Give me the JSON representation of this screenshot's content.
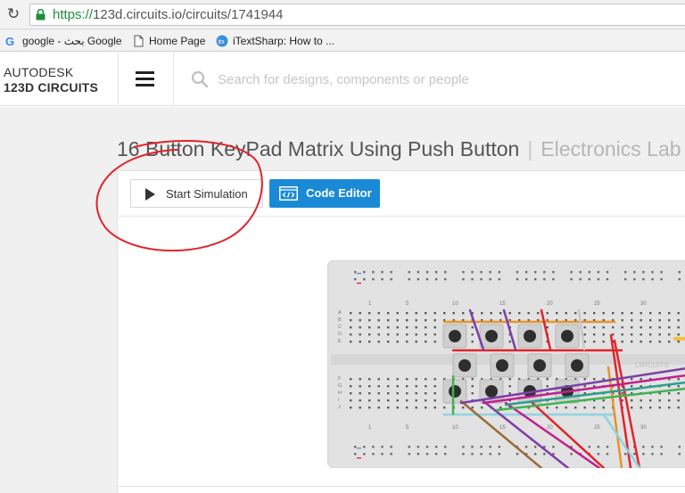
{
  "browser": {
    "url_scheme": "https://",
    "url_rest": "123d.circuits.io/circuits/1741944",
    "bookmarks": [
      {
        "label": "google - بحث Google",
        "icon": "google-icon"
      },
      {
        "label": "Home Page",
        "icon": "page-icon"
      },
      {
        "label": "iTextSharp: How to ...",
        "icon": "itextsharp-icon"
      }
    ]
  },
  "app": {
    "brand_line1": "AUTODESK",
    "brand_line2": "123D CIRCUITS",
    "search_placeholder": "Search for designs, components or people"
  },
  "circuit": {
    "title": "16 Button KeyPad Matrix Using Push Button",
    "separator": "|",
    "owner": "Electronics Lab"
  },
  "toolbar": {
    "start_simulation_label": "Start Simulation",
    "code_editor_label": "Code Editor"
  },
  "breadboard": {
    "column_numbers": [
      "1",
      "5",
      "10",
      "15",
      "20",
      "25",
      "30"
    ],
    "row_letters_top": [
      "A",
      "B",
      "C",
      "D",
      "E"
    ],
    "row_letters_bottom": [
      "F",
      "G",
      "H",
      "I",
      "J"
    ],
    "watermark": "CIRCUITS"
  },
  "colors": {
    "accent": "#1a8ad6",
    "annotation": "#e0242b",
    "url_green": "#1e8e3e"
  }
}
